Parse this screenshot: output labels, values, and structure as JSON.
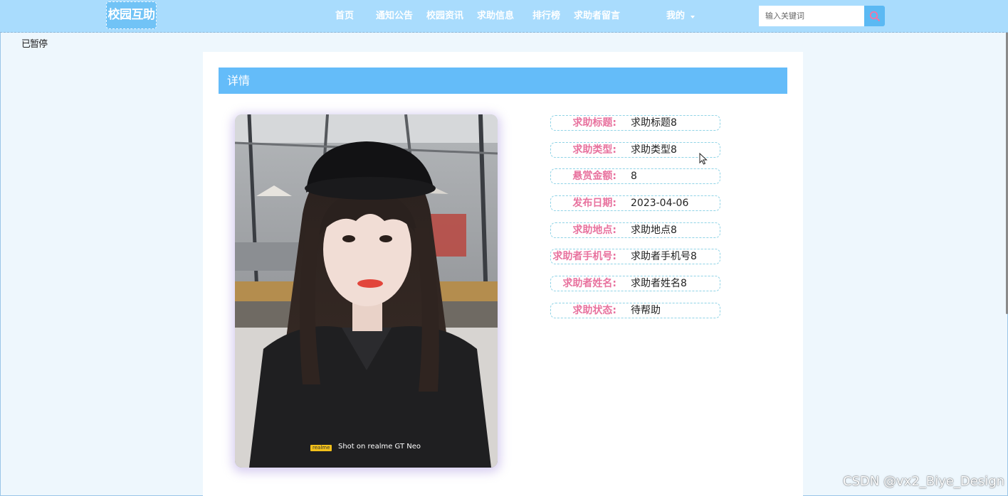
{
  "header": {
    "logo": "校园互助",
    "nav": [
      {
        "label": "首页"
      },
      {
        "label": "通知公告"
      },
      {
        "label": "校园资讯"
      },
      {
        "label": "求助信息"
      },
      {
        "label": "排行榜"
      },
      {
        "label": "求助者留言"
      }
    ],
    "my_label": "我的",
    "search_placeholder": "输入关键词",
    "search_icon": "search-icon"
  },
  "corner_text": "已暂停",
  "detail": {
    "title": "详情",
    "photo_watermark_brand": "realme",
    "photo_watermark_text": "Shot on realme GT Neo",
    "fields": [
      {
        "label": "求助标题:",
        "value": "求助标题8"
      },
      {
        "label": "求助类型:",
        "value": "求助类型8"
      },
      {
        "label": "悬赏金额:",
        "value": "8"
      },
      {
        "label": "发布日期:",
        "value": "2023-04-06"
      },
      {
        "label": "求助地点:",
        "value": "求助地点8"
      },
      {
        "label": "求助者手机号:",
        "value": "求助者手机号8"
      },
      {
        "label": "求助者姓名:",
        "value": "求助者姓名8"
      },
      {
        "label": "求助状态:",
        "value": "待帮助"
      }
    ]
  },
  "watermark": "CSDN @vx2_Biye_Design",
  "colors": {
    "header_bg": "#a9dcfd",
    "accent_blue": "#64bcf9",
    "label_pink": "#e8729e",
    "row_border": "#8fd3e6"
  }
}
